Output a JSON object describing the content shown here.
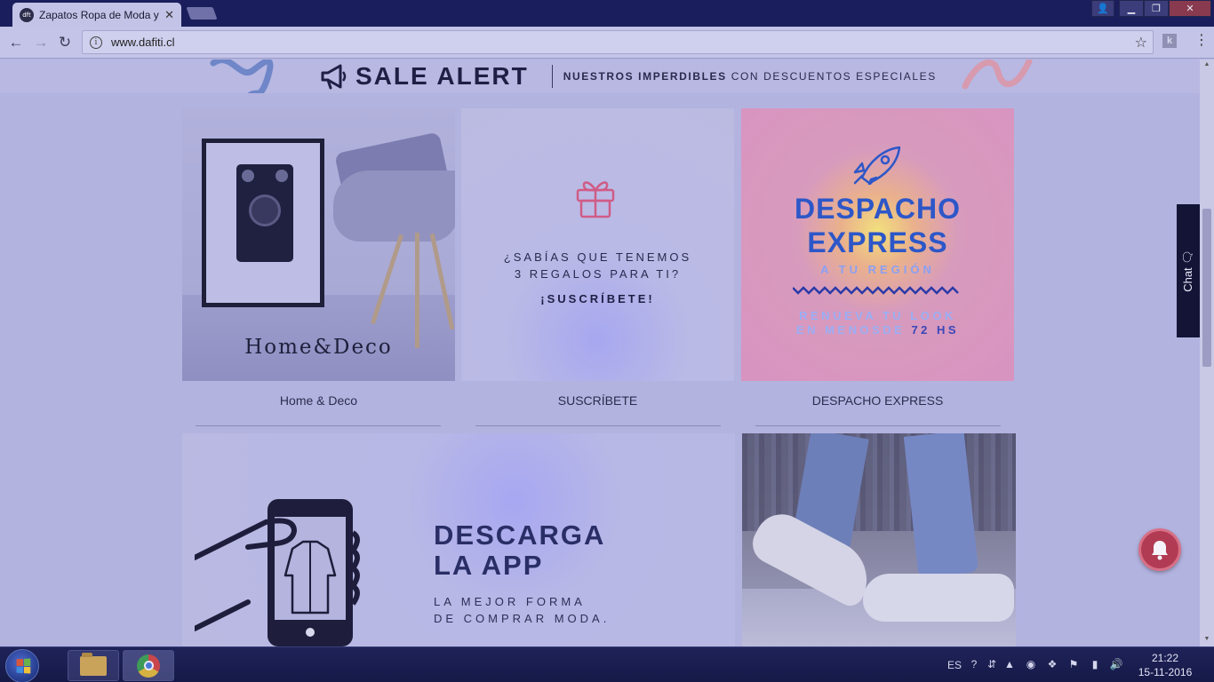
{
  "browser": {
    "tab_title": "Zapatos Ropa de Moda y",
    "favicon_text": "dft",
    "url": "www.dafiti.cl"
  },
  "banner": {
    "title": "SALE ALERT",
    "subtitle_bold": "NUESTROS IMPERDIBLES",
    "subtitle_rest": " CON DESCUENTOS ESPECIALES"
  },
  "tiles": {
    "home": {
      "caption": "Home&Deco",
      "label": "Home & Deco"
    },
    "subscribe": {
      "question_line1": "¿SABÍAS QUE TENEMOS",
      "question_line2": "3 REGALOS PARA TI?",
      "cta": "¡SUSCRÍBETE!",
      "label": "SUSCRÍBETE"
    },
    "despacho": {
      "title_line1": "DESPACHO",
      "title_line2": "EXPRESS",
      "subtitle": "A TU REGIÓN",
      "foot_line1": "RENUEVA TU LOOK",
      "foot_line2_a": "EN MENOSDE ",
      "foot_line2_b": "72 HS",
      "label": "DESPACHO EXPRESS"
    },
    "app": {
      "title_line1": "DESCARGA",
      "title_line2": "LA APP",
      "sub_line1": "LA MEJOR FORMA",
      "sub_line2": "DE COMPRAR MODA."
    }
  },
  "chat": {
    "label": "Chat"
  },
  "taskbar": {
    "language": "ES",
    "time": "21:22",
    "date": "15-11-2016"
  }
}
